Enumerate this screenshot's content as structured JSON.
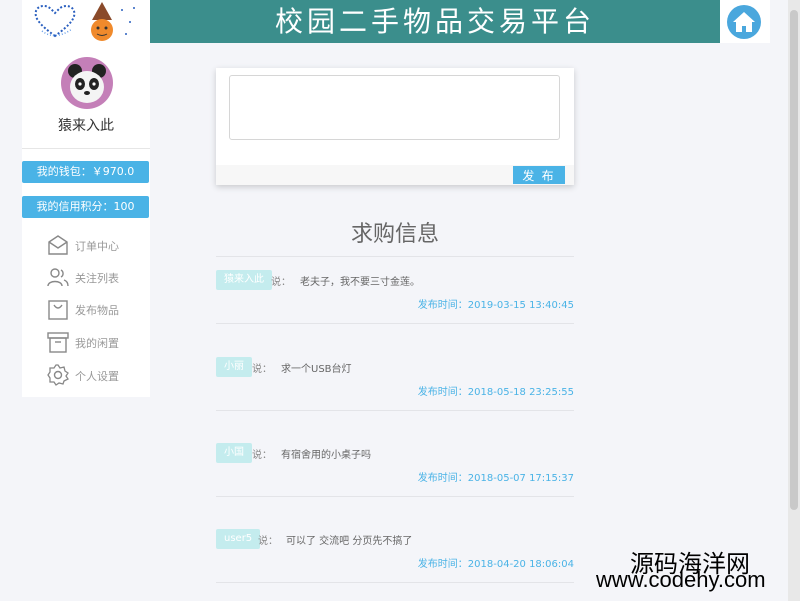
{
  "header": {
    "title": "校园二手物品交易平台",
    "home_icon": "home-icon"
  },
  "sidebar": {
    "username": "猿来入此",
    "wallet": "我的钱包：￥970.0",
    "credit": "我的信用积分：100",
    "menu": [
      {
        "label": "订单中心",
        "icon": "envelope-icon"
      },
      {
        "label": "关注列表",
        "icon": "users-icon"
      },
      {
        "label": "发布物品",
        "icon": "shopping-bag-icon"
      },
      {
        "label": "我的闲置",
        "icon": "archive-box-icon"
      },
      {
        "label": "个人设置",
        "icon": "gear-icon"
      }
    ]
  },
  "composer": {
    "textarea_value": "",
    "publish_label": "发 布"
  },
  "feed": {
    "title": "求购信息",
    "posts": [
      {
        "user": "猿来入此",
        "says": "说：",
        "content": "老夫子，我不要三寸金莲。",
        "time": "发布时间：2019-03-15 13:40:45"
      },
      {
        "user": "小丽",
        "says": "说：",
        "content": "求一个USB台灯",
        "time": "发布时间：2018-05-18 23:25:55"
      },
      {
        "user": "小国",
        "says": "说：",
        "content": "有宿舍用的小桌子吗",
        "time": "发布时间：2018-05-07 17:15:37"
      },
      {
        "user": "user5",
        "says": "说：",
        "content": "可以了 交流吧 分页先不搞了",
        "time": "发布时间：2018-04-20 18:06:04"
      }
    ]
  },
  "watermark": {
    "name": "源码海洋网",
    "url": "www.codehy.com"
  },
  "colors": {
    "title_bar": "#3b8e8c",
    "accent": "#4ab3e6",
    "tag": "#c4ecee"
  }
}
